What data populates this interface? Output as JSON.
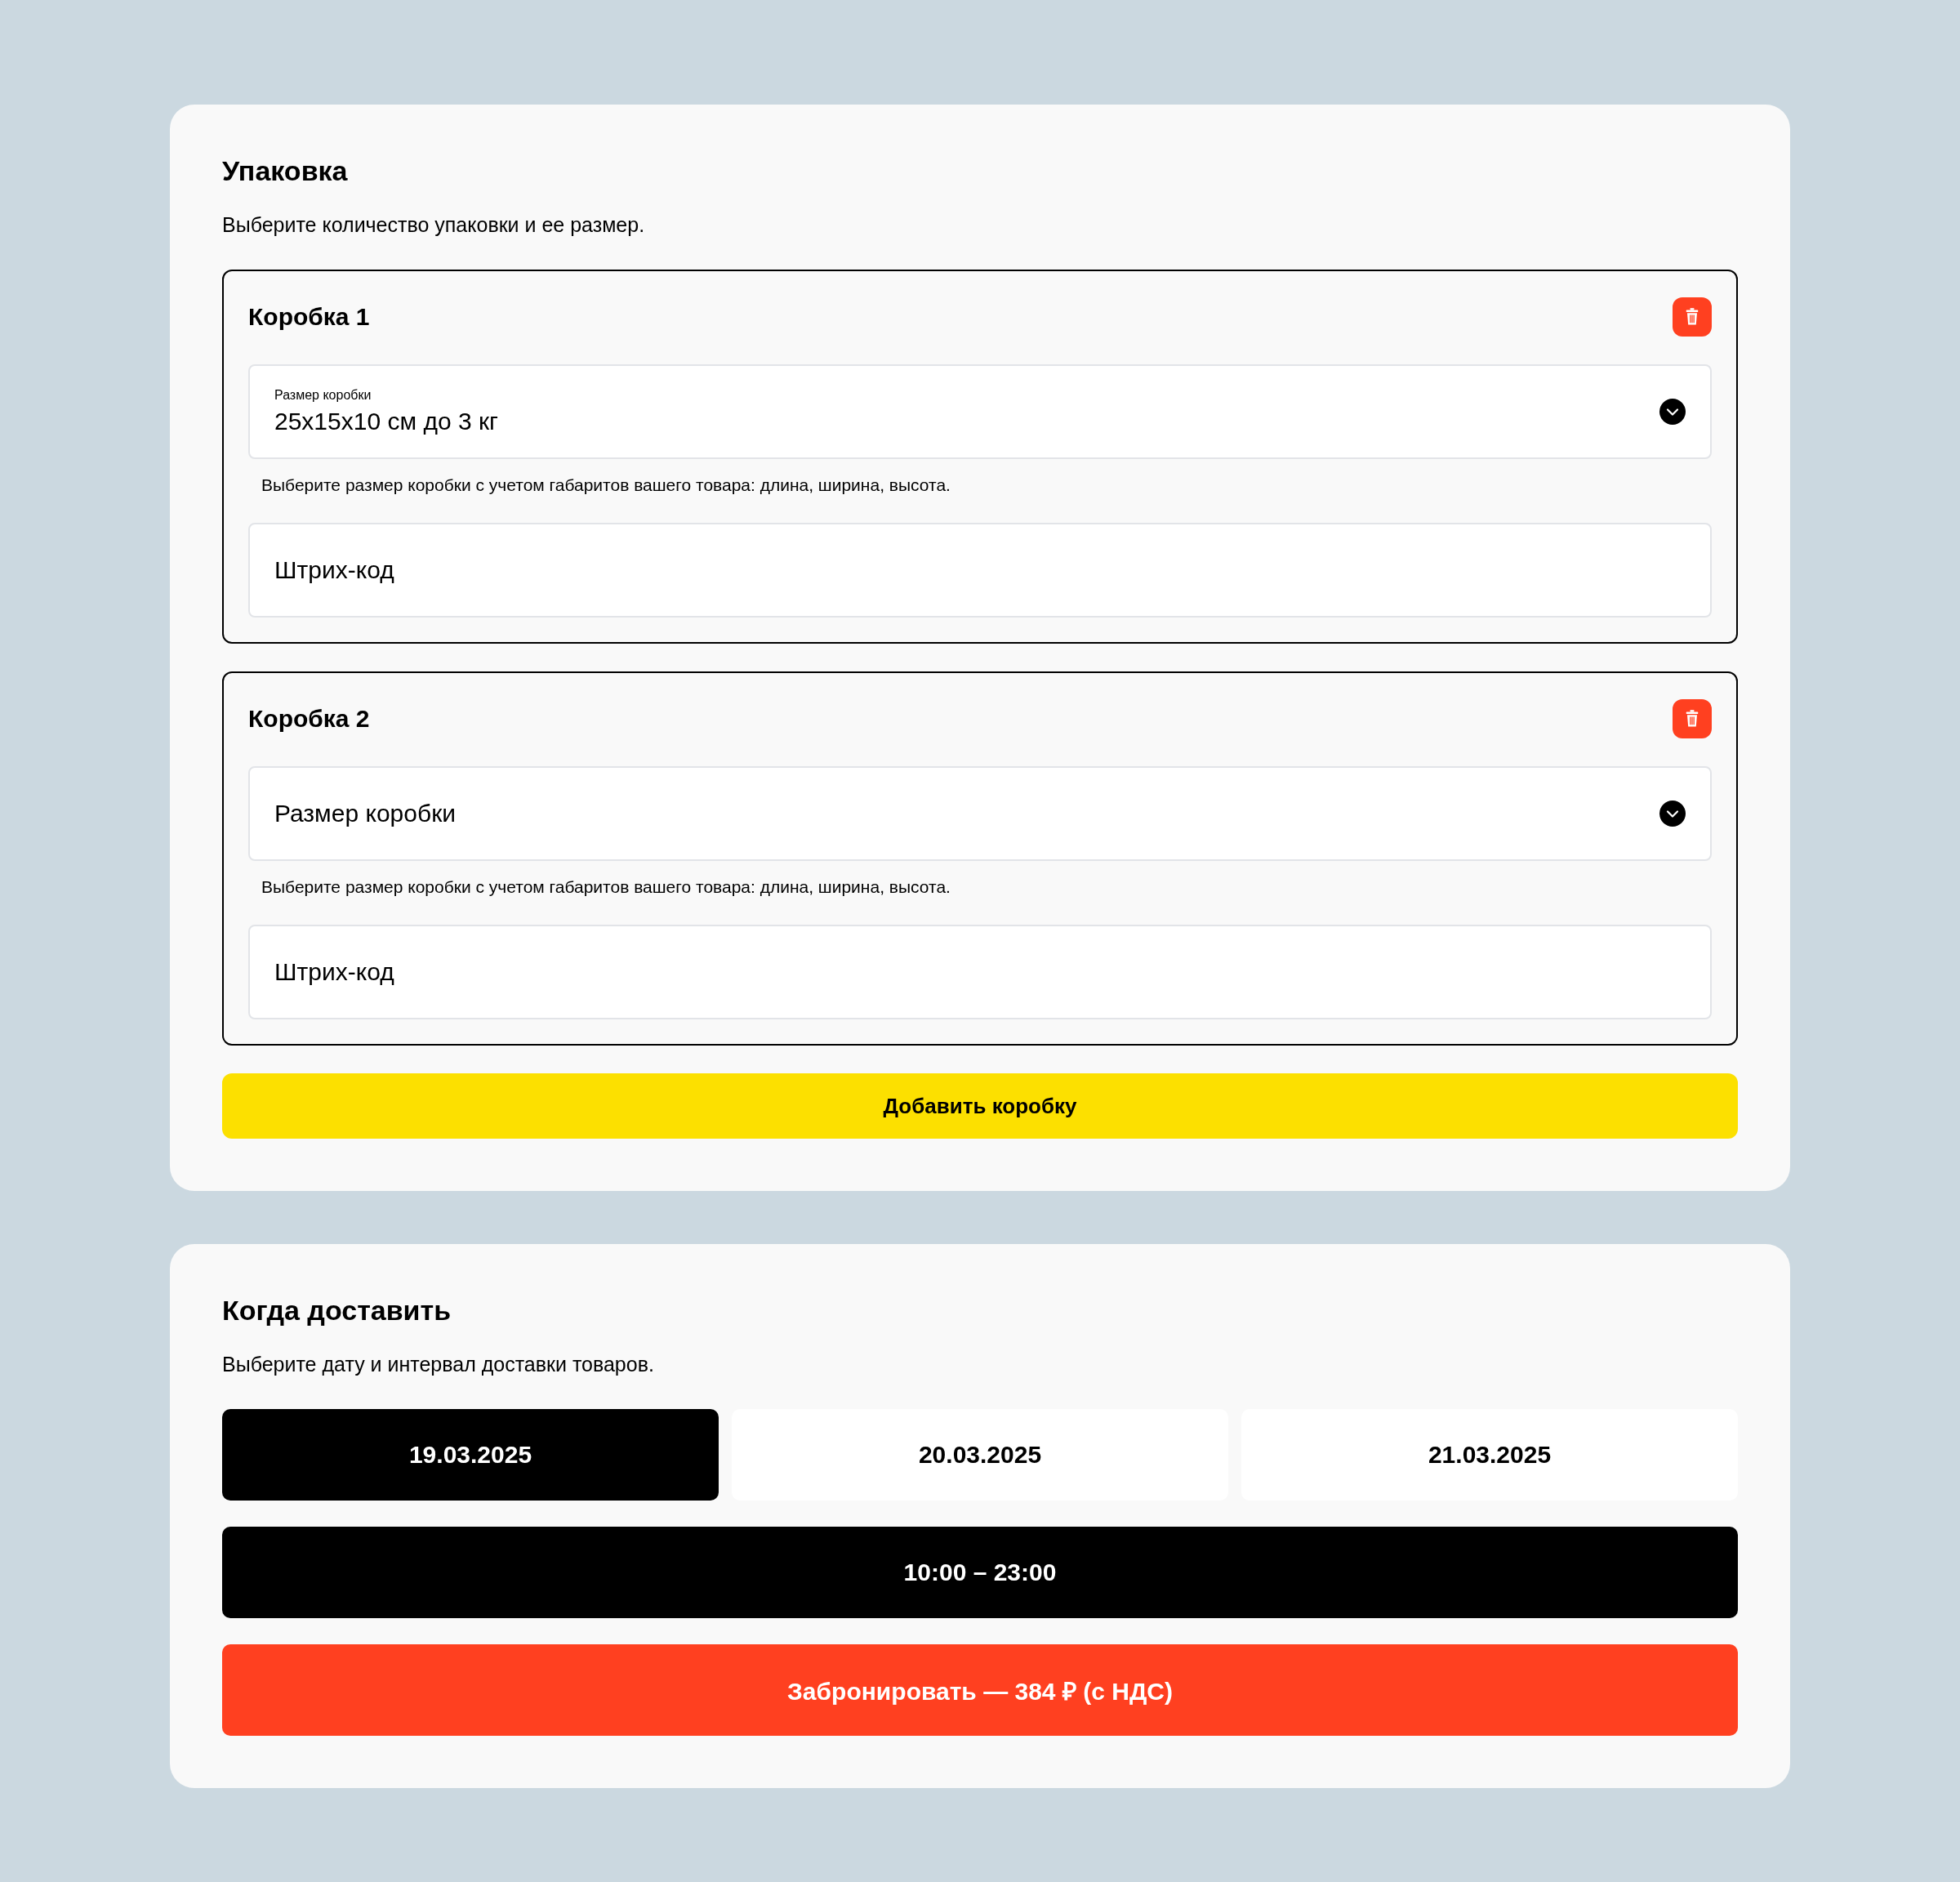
{
  "packaging": {
    "title": "Упаковка",
    "subtitle": "Выберите количество упаковки и ее размер.",
    "boxes": [
      {
        "title": "Коробка 1",
        "size": {
          "label": "Размер коробки",
          "value": "25x15x10 см до 3 кг"
        },
        "hint": "Выберите размер коробки с учетом габаритов вашего товара: длина, ширина, высота.",
        "barcode": {
          "placeholder": "Штрих-код"
        }
      },
      {
        "title": "Коробка 2",
        "size": {
          "placeholder": "Размер коробки"
        },
        "hint": "Выберите размер коробки с учетом габаритов вашего товара: длина, ширина, высота.",
        "barcode": {
          "placeholder": "Штрих-код"
        }
      }
    ],
    "add_button": "Добавить коробку"
  },
  "delivery": {
    "title": "Когда доставить",
    "subtitle": "Выберите дату и интервал доставки товаров.",
    "dates": [
      {
        "label": "19.03.2025",
        "selected": true
      },
      {
        "label": "20.03.2025",
        "selected": false
      },
      {
        "label": "21.03.2025",
        "selected": false
      }
    ],
    "interval": "10:00 – 23:00",
    "book_button": "Забронировать — 384 ₽ (с НДС)"
  }
}
